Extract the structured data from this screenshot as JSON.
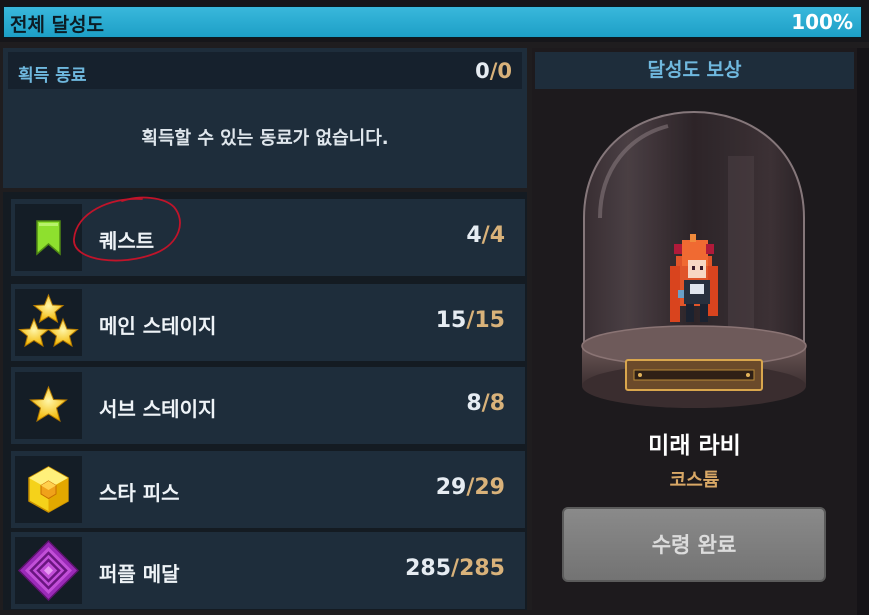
{
  "overall": {
    "label": "전체 달성도",
    "percent_text": "100%",
    "progress": 1.0
  },
  "acquired": {
    "title": "획득 동료",
    "current": "0",
    "total": "0",
    "empty_message": "획득할 수 있는 동료가 없습니다."
  },
  "categories": [
    {
      "label": "퀘스트",
      "current": "4",
      "total": "4",
      "icon": "bookmark-icon"
    },
    {
      "label": "메인 스테이지",
      "current": "15",
      "total": "15",
      "icon": "three-stars-icon"
    },
    {
      "label": "서브 스테이지",
      "current": "8",
      "total": "8",
      "icon": "star-icon"
    },
    {
      "label": "스타 피스",
      "current": "29",
      "total": "29",
      "icon": "star-piece-cube-icon"
    },
    {
      "label": "퍼플 메달",
      "current": "285",
      "total": "285",
      "icon": "purple-medal-icon"
    }
  ],
  "reward": {
    "header": "달성도 보상",
    "name": "미래 라비",
    "type": "코스튬",
    "button_label": "수령 완료"
  },
  "colors": {
    "accent_blue": "#6fb8de",
    "total_gold": "#d9b27a",
    "progress_fill": "#2aaad2"
  }
}
